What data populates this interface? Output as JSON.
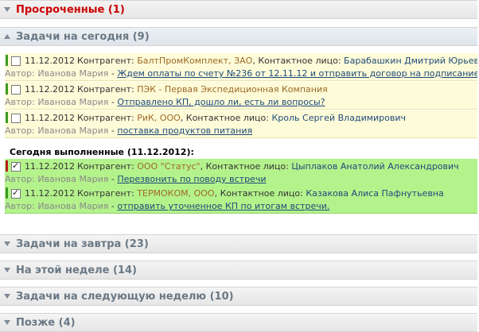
{
  "sections": {
    "overdue": {
      "title": "Просроченные (1)"
    },
    "today": {
      "title": "Задачи на сегодня (9)"
    },
    "tomorrow": {
      "title": "Задачи на завтра (23)"
    },
    "this_week": {
      "title": "На этой неделе (14)"
    },
    "next_week": {
      "title": "Задачи на следующую неделю (10)"
    },
    "later": {
      "title": "Позже (4)"
    }
  },
  "labels": {
    "counterparty": "Контрагент:",
    "contact_person": ", Контактное лицо:",
    "author": "Автор:",
    "dash": " - ",
    "done_today": "Сегодня выполненные (11.12.2012):"
  },
  "tasks": [
    {
      "date": "11.12.2012",
      "company": "БалтПромКомплект, ЗАО",
      "contact": "Барабашкин Дмитрий Юрьевич",
      "author": "Иванова Мария",
      "text": "Ждем оплаты по счету №236 от 12.11.12 и отправить договор на подписание",
      "checked": false,
      "stripe_color": "#3a9a22"
    },
    {
      "date": "11.12.2012",
      "company": "ПЭК - Первая Экспедиционная Компания",
      "contact": "",
      "author": "Иванова Мария",
      "text": "Отправлено КП, дошло ли, есть ли вопросы?",
      "checked": false,
      "stripe_color": "#3a9a22"
    },
    {
      "date": "11.12.2012",
      "company": "РиК, ООО",
      "contact": "Кроль Сергей Владимирович",
      "author": "Иванова Мария",
      "text": "поставка продуктов питания",
      "checked": false,
      "stripe_color": "#3a9a22"
    }
  ],
  "done_tasks": [
    {
      "date": "11.12.2012",
      "company": "ООО \"Статус\"",
      "contact": "Цыплаков Анатолий Александрович",
      "author": "Иванова Мария",
      "text": "Перезвонить по поводу встречи",
      "checked": true,
      "stripe_color": "#b81c1c"
    },
    {
      "date": "11.12.2012",
      "company": "ТЕРМОКОМ, ООО",
      "contact": "Казакова Алиса Пафнутьевна",
      "author": "Иванова Мария",
      "text": "отправить уточненное КП по итогам встречи.",
      "checked": true,
      "stripe_color": "#3a9a22"
    }
  ],
  "colors": {
    "overdue_title": "#cc0000",
    "section_title": "#6a7885",
    "pending_bg": "#fdfbd8",
    "done_bg": "#b4f28c",
    "company_text": "#9e6a26",
    "link_text": "#1f4a7a"
  }
}
